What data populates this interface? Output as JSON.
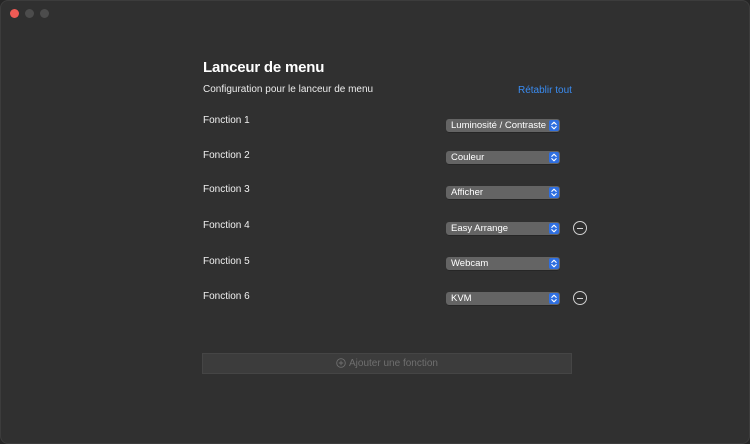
{
  "window": {
    "traffic_lights": {
      "close": "#ee5b55",
      "minimize": "#4c4c4c",
      "maximize": "#4c4c4c"
    }
  },
  "header": {
    "title": "Lanceur de menu",
    "subtitle": "Configuration pour le lanceur de menu",
    "reset_label": "Rétablir tout"
  },
  "functions": [
    {
      "label": "Fonction 1",
      "value": "Luminosité / Contraste",
      "removable": false
    },
    {
      "label": "Fonction 2",
      "value": "Couleur",
      "removable": false
    },
    {
      "label": "Fonction 3",
      "value": "Afficher",
      "removable": false
    },
    {
      "label": "Fonction 4",
      "value": "Easy Arrange",
      "removable": true
    },
    {
      "label": "Fonction 5",
      "value": "Webcam",
      "removable": false
    },
    {
      "label": "Fonction 6",
      "value": "KVM",
      "removable": true
    }
  ],
  "add_button": {
    "label": "Ajouter une fonction",
    "enabled": false
  },
  "colors": {
    "accent": "#2f6fe0",
    "link": "#3a8cf2",
    "background": "#303030"
  }
}
